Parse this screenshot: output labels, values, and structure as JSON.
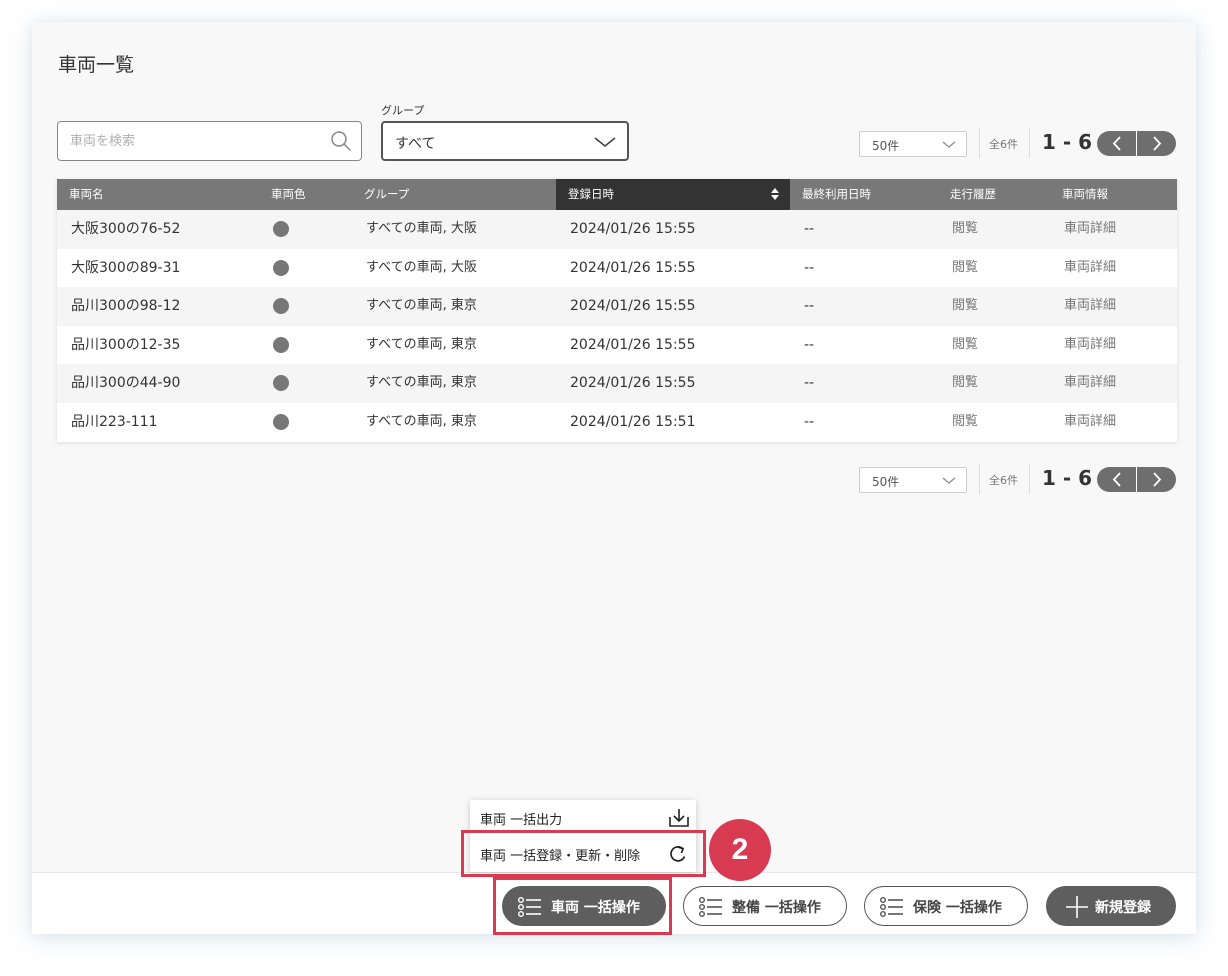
{
  "page": {
    "title": "車両一覧"
  },
  "search": {
    "placeholder": "車両を検索",
    "value": ""
  },
  "group_filter": {
    "label": "グループ",
    "value": "すべて"
  },
  "pager": {
    "per_page": "50件",
    "total": "全6件",
    "range": "1 - 6"
  },
  "table": {
    "columns": [
      "車両名",
      "車両色",
      "グループ",
      "登録日時",
      "最終利用日時",
      "走行履歴",
      "車両情報"
    ],
    "sorted_column": "登録日時",
    "rows": [
      {
        "name": "大阪300の76-52",
        "group": "すべての車両, 大阪",
        "registered": "2024/01/26 15:55",
        "last_used": "--",
        "history": "閲覧",
        "info": "車両詳細"
      },
      {
        "name": "大阪300の89-31",
        "group": "すべての車両, 大阪",
        "registered": "2024/01/26 15:55",
        "last_used": "--",
        "history": "閲覧",
        "info": "車両詳細"
      },
      {
        "name": "品川300の98-12",
        "group": "すべての車両, 東京",
        "registered": "2024/01/26 15:55",
        "last_used": "--",
        "history": "閲覧",
        "info": "車両詳細"
      },
      {
        "name": "品川300の12-35",
        "group": "すべての車両, 東京",
        "registered": "2024/01/26 15:55",
        "last_used": "--",
        "history": "閲覧",
        "info": "車両詳細"
      },
      {
        "name": "品川300の44-90",
        "group": "すべての車両, 東京",
        "registered": "2024/01/26 15:55",
        "last_used": "--",
        "history": "閲覧",
        "info": "車両詳細"
      },
      {
        "name": "品川223-111",
        "group": "すべての車両, 東京",
        "registered": "2024/01/26 15:51",
        "last_used": "--",
        "history": "閲覧",
        "info": "車両詳細"
      }
    ]
  },
  "popup_menu": {
    "items": [
      {
        "label": "車両 一括出力",
        "icon": "download-icon"
      },
      {
        "label": "車両 一括登録・更新・削除",
        "icon": "refresh-icon"
      }
    ]
  },
  "annotation": {
    "step": "2",
    "color": "#d83a52"
  },
  "footer": {
    "vehicle_bulk": "車両 一括操作",
    "maintenance_bulk": "整備 一括操作",
    "insurance_bulk": "保険 一括操作",
    "new_register": "新規登録"
  },
  "colors": {
    "header_bg": "#787878",
    "sorted_header_bg": "#333333",
    "accent": "#d83a52",
    "dark_button": "#5e5e5e"
  }
}
